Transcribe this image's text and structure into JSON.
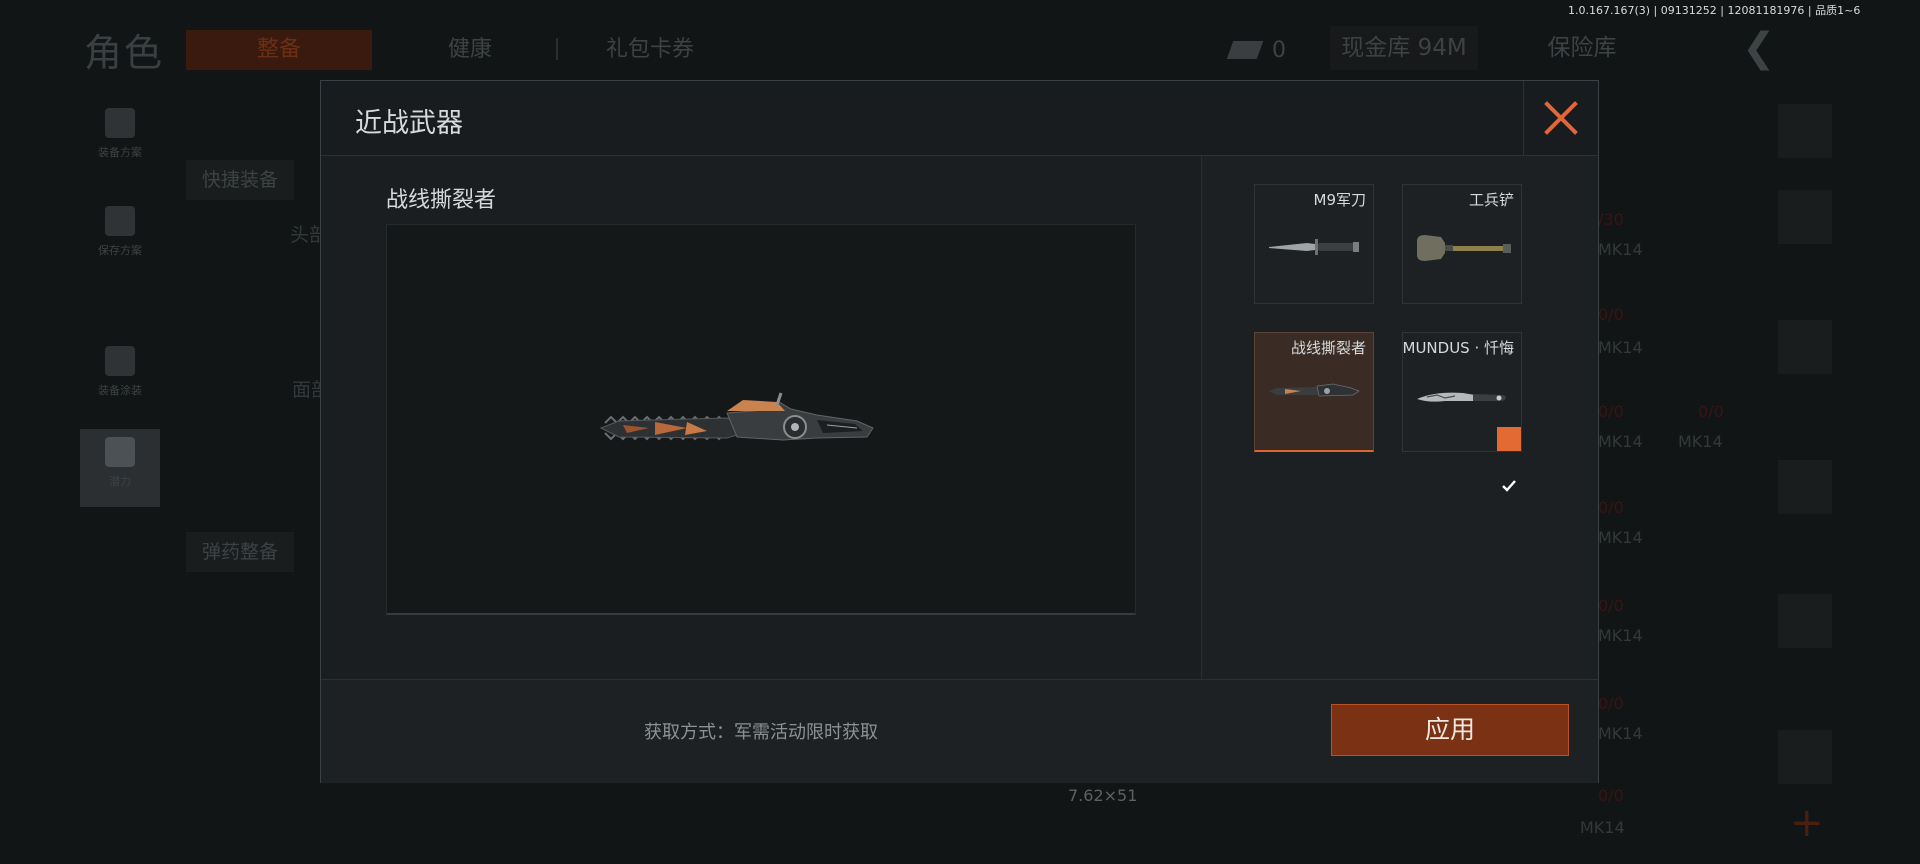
{
  "status": {
    "version": "1.0.167.167(3) | 09131252 | 12081181976 | 品质1~6"
  },
  "background": {
    "page_title": "角色",
    "tabs": [
      {
        "label": "整备"
      },
      {
        "label": "健康"
      },
      {
        "label": "礼包卡券"
      }
    ],
    "currency_value": "0",
    "cash_vault": "现金库 94M",
    "insurance_vault": "保险库",
    "left_rail": [
      {
        "label": "装备方案",
        "icon": "loadout-icon"
      },
      {
        "label": "保存方案",
        "icon": "save-icon"
      },
      {
        "label": "装备涂装",
        "icon": "helmet-icon"
      },
      {
        "label": "潜力",
        "icon": "potential-icon"
      }
    ],
    "quick_equip": "快捷装备",
    "ammo_equip": "弹药整备",
    "slot_head": "头部",
    "slot_face": "面部",
    "ammo_caliber": "7.62×51",
    "right_items": [
      {
        "count": "/30",
        "name": "MK14"
      },
      {
        "count": "0/0",
        "name": "MK14"
      },
      {
        "count": "0/0",
        "name": "MK14"
      },
      {
        "count": "0/0",
        "name": "MK14"
      },
      {
        "count": "0/0",
        "name": "MK14"
      },
      {
        "count": "0/0",
        "name": "MK14"
      },
      {
        "count": "0/0",
        "name": "MK14"
      }
    ],
    "right_extra": {
      "count": "0/0",
      "name": "MK14"
    }
  },
  "modal": {
    "title": "近战武器",
    "selected_item_name": "战线撕裂者",
    "items": [
      {
        "name": "M9军刀",
        "icon": "bayonet-icon",
        "selected": false,
        "equipped": false
      },
      {
        "name": "工兵铲",
        "icon": "shovel-icon",
        "selected": false,
        "equipped": false
      },
      {
        "name": "战线撕裂者",
        "icon": "chainsaw-icon",
        "selected": true,
        "equipped": false
      },
      {
        "name": "MUNDUS · 忏悔",
        "icon": "karambit-icon",
        "selected": false,
        "equipped": true
      }
    ],
    "acquire_text": "获取方式：军需活动限时获取",
    "apply_label": "应用"
  },
  "colors": {
    "accent": "#e36a33",
    "apply_bg": "#7b3214",
    "modal_bg": "#1a1e20"
  }
}
